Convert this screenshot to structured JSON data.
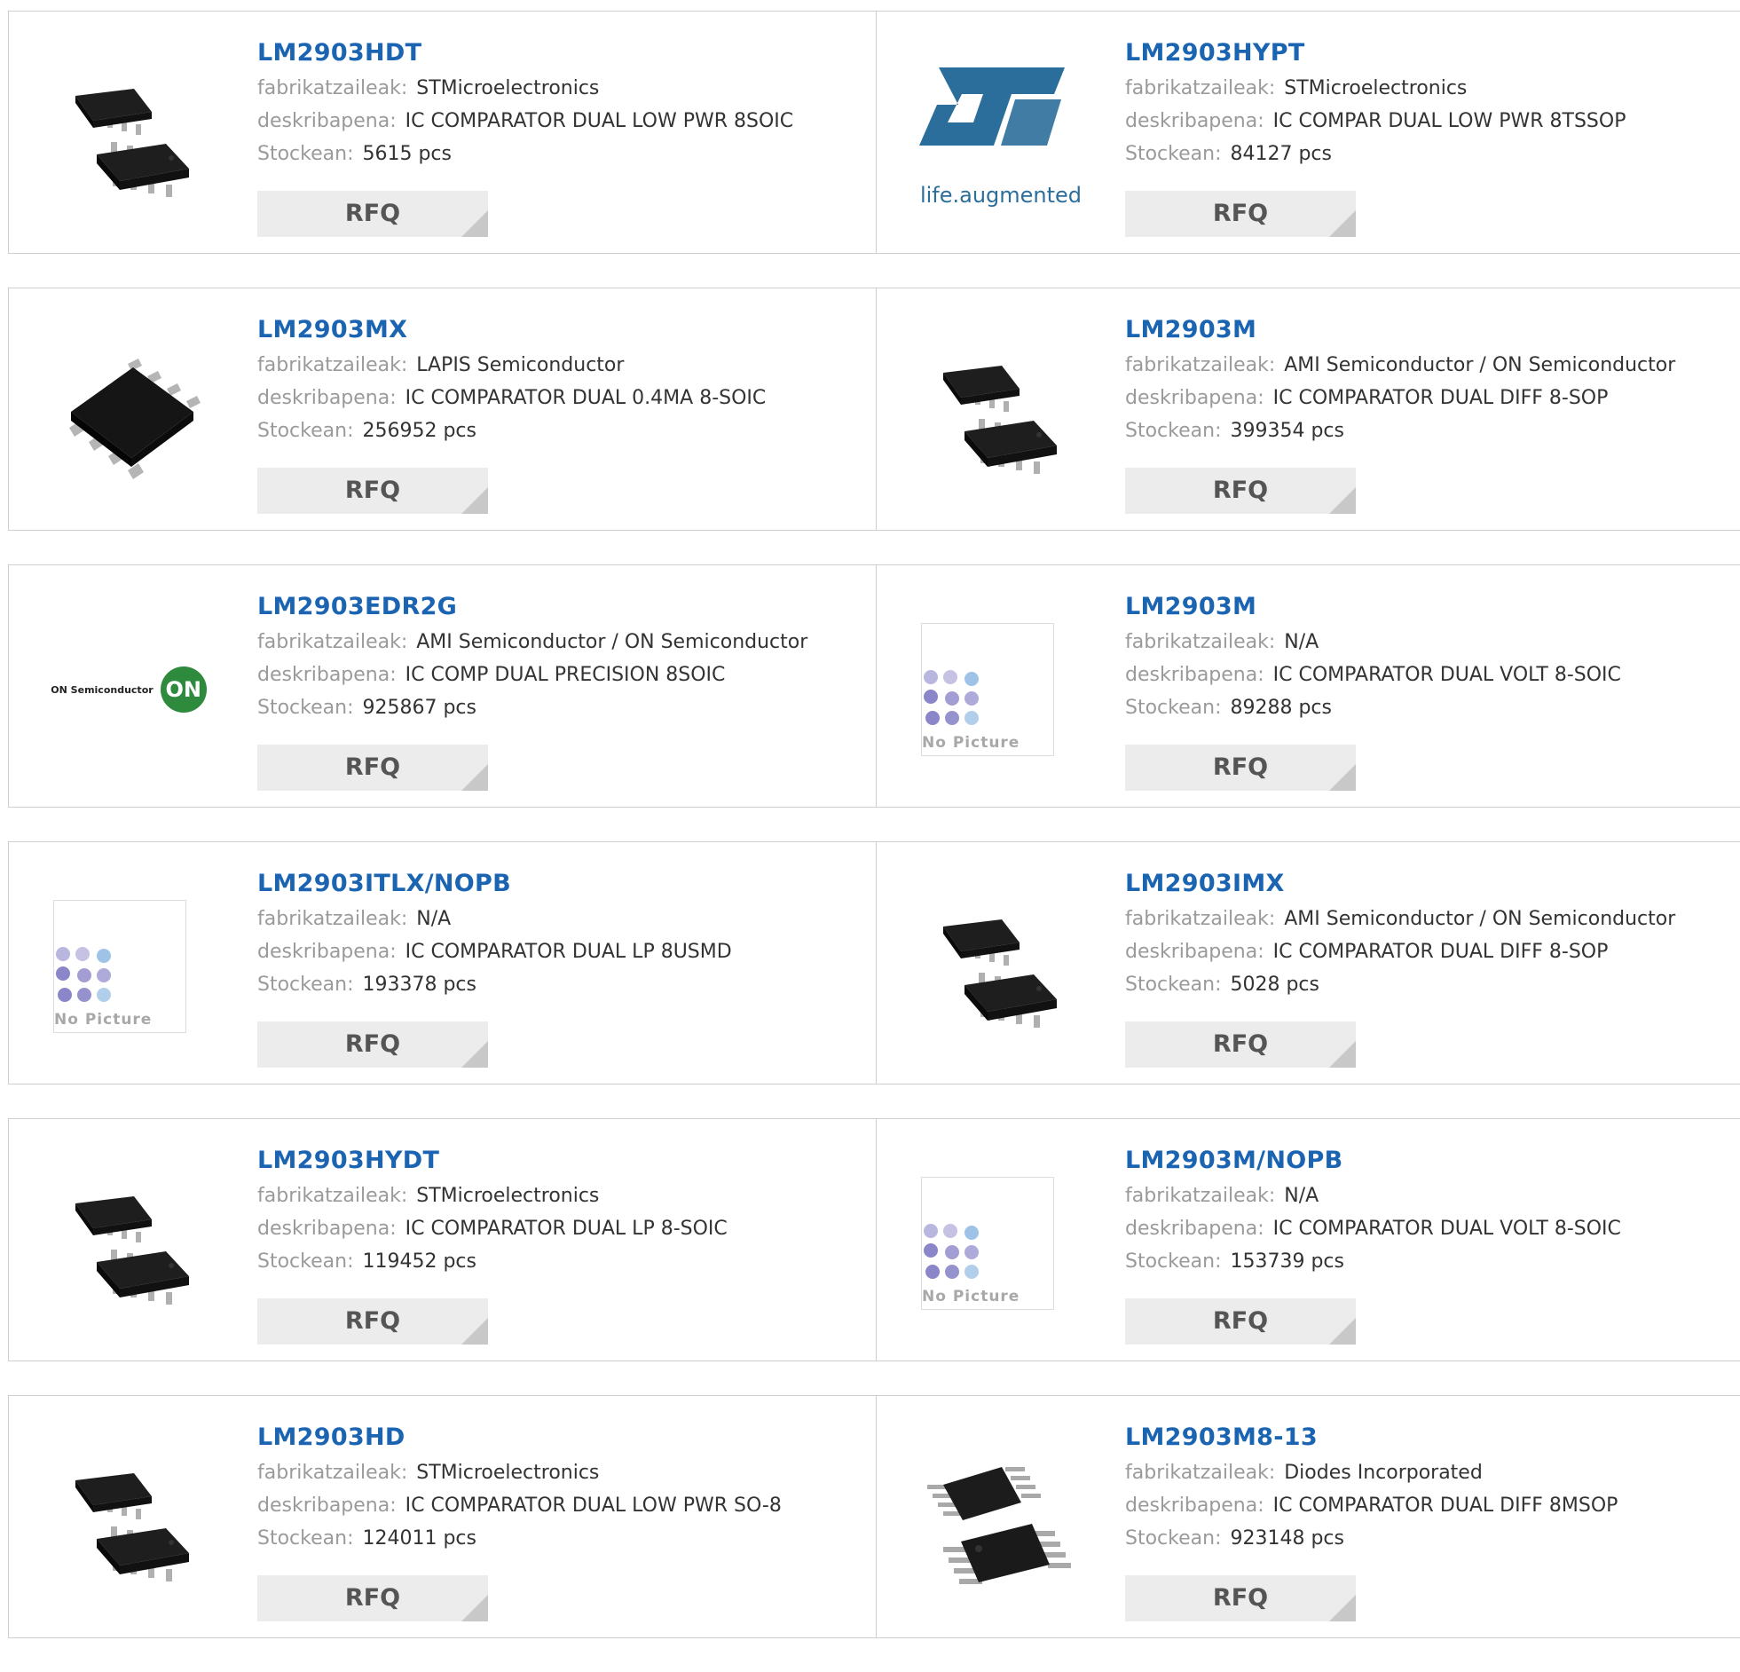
{
  "labels": {
    "manufacturer": "fabrikatzaileak:",
    "description": "deskribapena:",
    "stock": "Stockean:",
    "rfq": "RFQ",
    "no_picture": "No Picture",
    "st_tagline": "life.augmented",
    "on_semi_text": "ON Semiconductor",
    "on_semi_badge": "ON"
  },
  "products": [
    {
      "part": "LM2903HDT",
      "manufacturer": "STMicroelectronics",
      "description": "IC COMPARATOR DUAL LOW PWR 8SOIC",
      "stock": "5615 pcs",
      "image": "soic8-chip-pair"
    },
    {
      "part": "LM2903HYPT",
      "manufacturer": "STMicroelectronics",
      "description": "IC COMPAR DUAL LOW PWR 8TSSOP",
      "stock": "84127 pcs",
      "image": "st-logo"
    },
    {
      "part": "LM2903MX",
      "manufacturer": "LAPIS Semiconductor",
      "description": "IC COMPARATOR DUAL 0.4MA 8-SOIC",
      "stock": "256952 pcs",
      "image": "soic8-chip-single"
    },
    {
      "part": "LM2903M",
      "manufacturer": "AMI Semiconductor / ON Semiconductor",
      "description": "IC COMPARATOR DUAL DIFF 8-SOP",
      "stock": "399354 pcs",
      "image": "soic8-chip-pair"
    },
    {
      "part": "LM2903EDR2G",
      "manufacturer": "AMI Semiconductor / ON Semiconductor",
      "description": "IC COMP DUAL PRECISION 8SOIC",
      "stock": "925867 pcs",
      "image": "on-semi-logo"
    },
    {
      "part": "LM2903M",
      "manufacturer": "N/A",
      "description": "IC COMPARATOR DUAL VOLT 8-SOIC",
      "stock": "89288 pcs",
      "image": "no-picture"
    },
    {
      "part": "LM2903ITLX/NOPB",
      "manufacturer": "N/A",
      "description": "IC COMPARATOR DUAL LP 8USMD",
      "stock": "193378 pcs",
      "image": "no-picture"
    },
    {
      "part": "LM2903IMX",
      "manufacturer": "AMI Semiconductor / ON Semiconductor",
      "description": "IC COMPARATOR DUAL DIFF 8-SOP",
      "stock": "5028 pcs",
      "image": "soic8-chip-pair"
    },
    {
      "part": "LM2903HYDT",
      "manufacturer": "STMicroelectronics",
      "description": "IC COMPARATOR DUAL LP 8-SOIC",
      "stock": "119452 pcs",
      "image": "soic8-chip-pair"
    },
    {
      "part": "LM2903M/NOPB",
      "manufacturer": "N/A",
      "description": "IC COMPARATOR DUAL VOLT 8-SOIC",
      "stock": "153739 pcs",
      "image": "no-picture"
    },
    {
      "part": "LM2903HD",
      "manufacturer": "STMicroelectronics",
      "description": "IC COMPARATOR DUAL LOW PWR SO-8",
      "stock": "124011 pcs",
      "image": "soic8-chip-pair"
    },
    {
      "part": "LM2903M8-13",
      "manufacturer": "Diodes Incorporated",
      "description": "IC COMPARATOR DUAL DIFF 8MSOP",
      "stock": "923148 pcs",
      "image": "msop8-chip-pair"
    }
  ],
  "colors": {
    "part_link": "#1b64b2",
    "label_gray": "#9a9a9a",
    "value_text": "#333333",
    "rfq_bg": "#ececec",
    "border": "#cfcfcf",
    "st_blue": "#2c6e9b",
    "on_green": "#2e8b3e"
  }
}
